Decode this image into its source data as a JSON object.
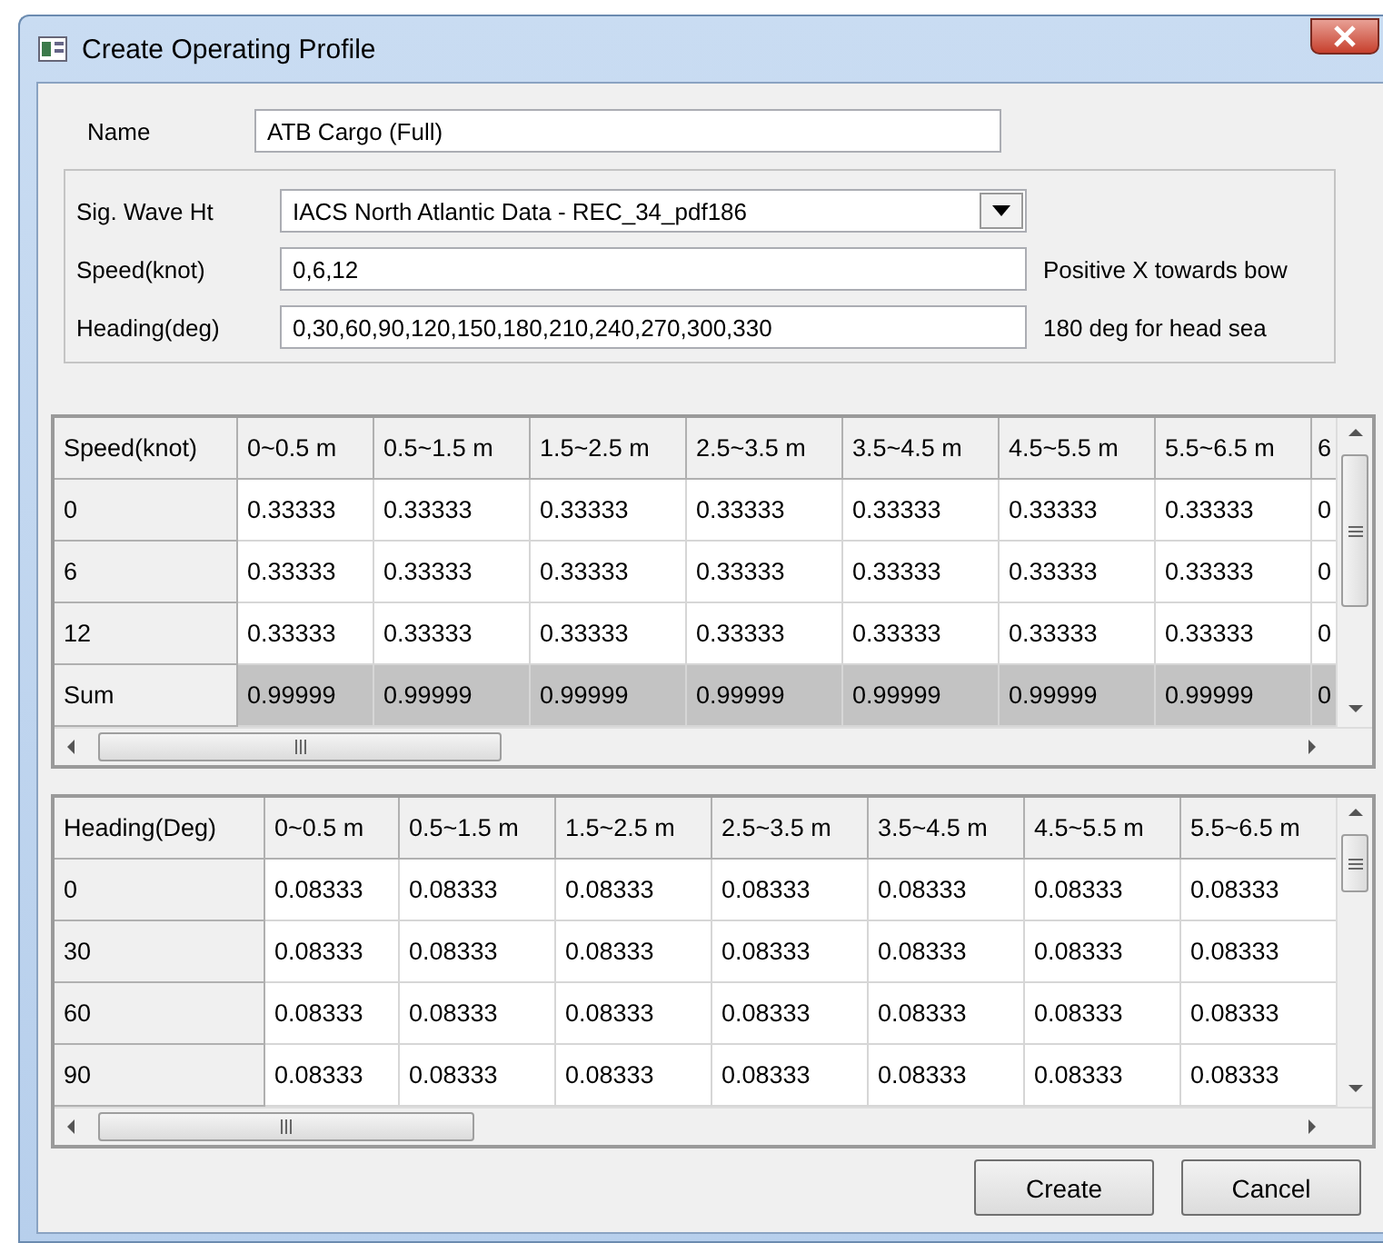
{
  "window": {
    "title": "Create Operating Profile"
  },
  "form": {
    "name": {
      "label": "Name",
      "value": "ATB Cargo (Full)"
    },
    "wave": {
      "label": "Sig. Wave Ht",
      "value": "IACS North Atlantic Data - REC_34_pdf186"
    },
    "speed": {
      "label": "Speed(knot)",
      "value": "0,6,12",
      "note": "Positive X towards bow"
    },
    "heading": {
      "label": "Heading(deg)",
      "value": "0,30,60,90,120,150,180,210,240,270,300,330",
      "note": "180 deg for head sea"
    }
  },
  "speed_table": {
    "columns": [
      "Speed(knot)",
      "0~0.5 m",
      "0.5~1.5 m",
      "1.5~2.5 m",
      "2.5~3.5 m",
      "3.5~4.5 m",
      "4.5~5.5 m",
      "5.5~6.5 m",
      "6"
    ],
    "rows": [
      {
        "shaded": false,
        "cells": [
          "0",
          "0.33333",
          "0.33333",
          "0.33333",
          "0.33333",
          "0.33333",
          "0.33333",
          "0.33333",
          "0"
        ]
      },
      {
        "shaded": false,
        "cells": [
          "6",
          "0.33333",
          "0.33333",
          "0.33333",
          "0.33333",
          "0.33333",
          "0.33333",
          "0.33333",
          "0"
        ]
      },
      {
        "shaded": false,
        "cells": [
          "12",
          "0.33333",
          "0.33333",
          "0.33333",
          "0.33333",
          "0.33333",
          "0.33333",
          "0.33333",
          "0"
        ]
      },
      {
        "shaded": true,
        "cells": [
          "Sum",
          "0.99999",
          "0.99999",
          "0.99999",
          "0.99999",
          "0.99999",
          "0.99999",
          "0.99999",
          "0"
        ]
      }
    ]
  },
  "heading_table": {
    "columns": [
      "Heading(Deg)",
      "0~0.5 m",
      "0.5~1.5 m",
      "1.5~2.5 m",
      "2.5~3.5 m",
      "3.5~4.5 m",
      "4.5~5.5 m",
      "5.5~6.5 m"
    ],
    "rows": [
      {
        "shaded": false,
        "cells": [
          "0",
          "0.08333",
          "0.08333",
          "0.08333",
          "0.08333",
          "0.08333",
          "0.08333",
          "0.08333"
        ]
      },
      {
        "shaded": false,
        "cells": [
          "30",
          "0.08333",
          "0.08333",
          "0.08333",
          "0.08333",
          "0.08333",
          "0.08333",
          "0.08333"
        ]
      },
      {
        "shaded": false,
        "cells": [
          "60",
          "0.08333",
          "0.08333",
          "0.08333",
          "0.08333",
          "0.08333",
          "0.08333",
          "0.08333"
        ]
      },
      {
        "shaded": false,
        "cells": [
          "90",
          "0.08333",
          "0.08333",
          "0.08333",
          "0.08333",
          "0.08333",
          "0.08333",
          "0.08333"
        ]
      }
    ]
  },
  "buttons": [
    "Create",
    "Cancel"
  ]
}
